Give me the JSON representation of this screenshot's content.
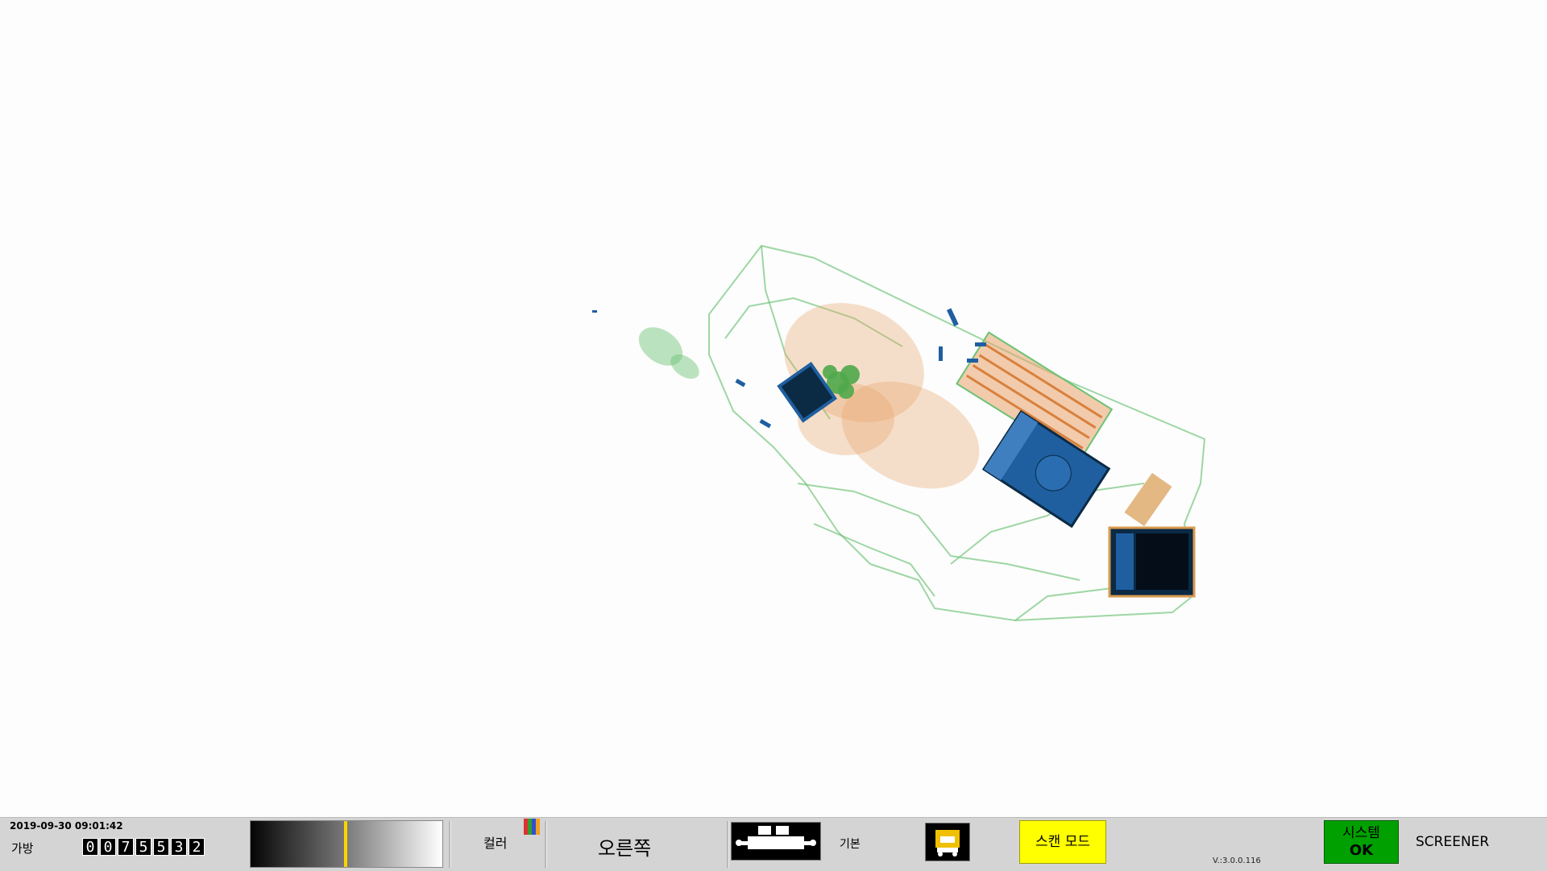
{
  "scan_image": {
    "description_icon": "xray-scan-image",
    "colors": {
      "organic": "#e8a36a",
      "mixed": "#6cc274",
      "inorganic": "#1f5fa0",
      "dense": "#0b2a44"
    }
  },
  "statusbar": {
    "datetime": "2019-09-30 09:01:42",
    "bag_label": "가방",
    "bag_count_digits": [
      "0",
      "0",
      "7",
      "5",
      "5",
      "3",
      "2"
    ],
    "grayscale_level": 0.5,
    "color_label": "컬러",
    "color_icon_colors": [
      "#e03030",
      "#30a030",
      "#3050d0",
      "#f0a020"
    ],
    "direction": "오른쪽",
    "conveyor_icon": "conveyor-icon",
    "basic_label": "기본",
    "shield_icon": "operator-shield-icon",
    "scan_mode": "스캔 모드",
    "version": "V.:3.0.0.116",
    "system_line1": "시스템",
    "system_line2": "OK",
    "user_role": "SCREENER"
  }
}
